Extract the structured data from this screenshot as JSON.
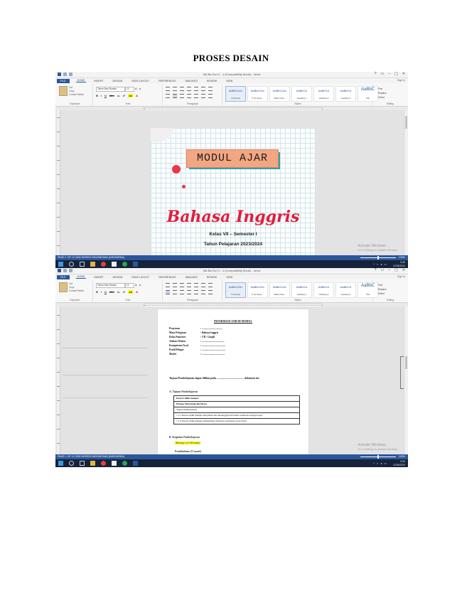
{
  "page": {
    "title": "PROSES DESAIN"
  },
  "word": {
    "doc_title": "MA Ba-Sar S... d (Compatibility Mode) - Word",
    "window_controls": [
      "?",
      "▭",
      "–",
      "▢",
      "✕"
    ],
    "signin": "Sign in",
    "tabs": [
      "FILE",
      "HOME",
      "INSERT",
      "DESIGN",
      "PAGE LAYOUT",
      "REFERENCES",
      "MAILINGS",
      "REVIEW",
      "VIEW"
    ],
    "clipboard": {
      "lines": [
        "Cut",
        "Copy",
        "Format Painter"
      ],
      "label": "Clipboard"
    },
    "font": {
      "name": "Times New Roman",
      "size": "12",
      "label": "Font"
    },
    "paragraph": {
      "label": "Paragraph"
    },
    "styles": {
      "label": "Styles",
      "items": [
        {
          "sample": "AaBbCcDc",
          "name": "¶ Normal"
        },
        {
          "sample": "AaBbCcDc",
          "name": "¶ No Spac..."
        },
        {
          "sample": "AaBbCcDc",
          "name": "Table Para..."
        },
        {
          "sample": "AaBbCcl",
          "name": "Heading 1"
        },
        {
          "sample": "AaBbCcl",
          "name": "Heading 2"
        },
        {
          "sample": "AaBbCcl",
          "name": "Heading 3"
        },
        {
          "sample": "AaBbC",
          "name": "Title"
        },
        {
          "sample": "AaBbCcD",
          "name": "Subtitle"
        }
      ]
    },
    "editing": {
      "lines": [
        "Find",
        "Replace",
        "Select"
      ],
      "label": "Editing"
    },
    "status_left": "PAGE 1 OF 13    2052 WORDS    INDONESIAN (INDONESIA)",
    "zoom": "100%",
    "activate_title": "Activate Windows",
    "activate_sub": "Go to Settings to activate Windows.",
    "tray_time": "8:08",
    "tray_date": "12/06/2024"
  },
  "cover": {
    "banner": "MODUL AJAR",
    "subject": "Bahasa Inggris",
    "class_line": "Kelas VII – Semester I",
    "year_line": "Tahun Pelajaran 2023/2024"
  },
  "doc": {
    "heading": "INFORMASI UMUM MODUL",
    "info": [
      {
        "k": "Penyusun",
        "v": ": ................................"
      },
      {
        "k": "Mata Pelajaran",
        "v": ": Bahasa Inggris"
      },
      {
        "k": "Kelas/Semester",
        "v": ": VII / Ganjil"
      },
      {
        "k": "Alokasi Waktu",
        "v": ": ..................................."
      },
      {
        "k": "Kompetensi Awal",
        "v": ": ....................................."
      },
      {
        "k": "Profil Pelajar",
        "v": ": ....................................."
      },
      {
        "k": "Model",
        "v": ": ...................................."
      }
    ],
    "intro": "Tujuan Pembelajaran dapat dilihat pada ........................................ dokumen ini.",
    "section_a": "A. Tujuan Pembelajaran",
    "table": [
      {
        "text": "Peserta didik mampu:",
        "bold": true
      },
      {
        "text": "Elemen Menyimak-Berbicara",
        "bold": true
      },
      {
        "text": "Tujuan Pembelajaran",
        "bold": false
      },
      {
        "text": "7.1.1 Peserta didik mampu menyimak dan menanggapi informasi sederhana dengan tepat.",
        "bold": false
      },
      {
        "text": "7.1.2 Peserta didik mampu memberikan informasi sederhana secara lisan.",
        "bold": false
      }
    ],
    "section_b": "B. Kegiatan Pembelajaran",
    "meeting": "Meeting 1 (2×40 menit)",
    "prelim": "Pendahuluan (15 menit)"
  }
}
